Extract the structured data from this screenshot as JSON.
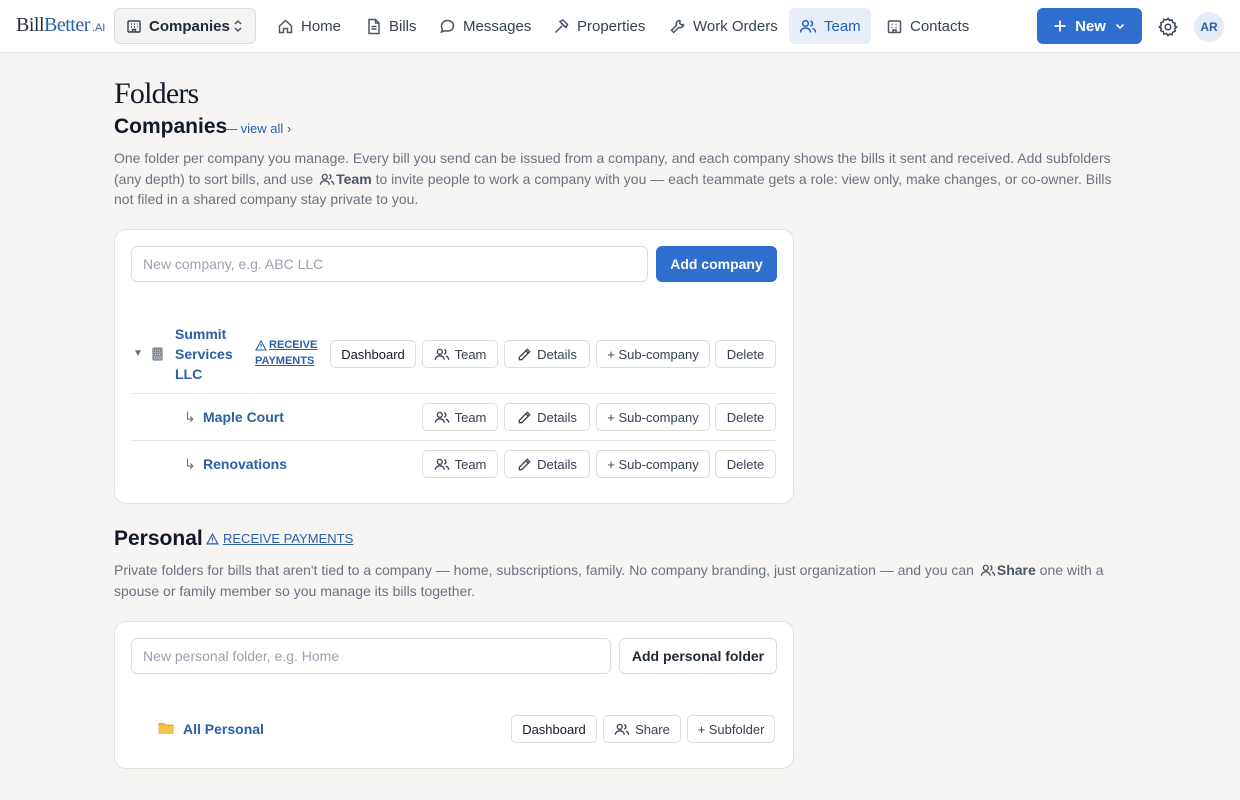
{
  "nav": {
    "logo": {
      "part1": "Bill",
      "part2": "Better",
      "suffix": ".AI"
    },
    "switcher": {
      "label": "Companies"
    },
    "items": [
      {
        "label": "Home",
        "icon": "home-icon"
      },
      {
        "label": "Bills",
        "icon": "document-icon"
      },
      {
        "label": "Messages",
        "icon": "message-icon"
      },
      {
        "label": "Properties",
        "icon": "hammer-icon"
      },
      {
        "label": "Work Orders",
        "icon": "wrench-icon"
      },
      {
        "label": "Team",
        "icon": "users-icon",
        "active": true
      },
      {
        "label": "Contacts",
        "icon": "building-icon"
      }
    ],
    "new_label": "New",
    "avatar_initials": "AR"
  },
  "page": {
    "title": "Folders"
  },
  "companies": {
    "title": "Companies",
    "view_all": "— view all ›",
    "desc_1": "One folder per company you manage. Every bill you send can be issued from a company, and each company shows the bills it sent and received. Add subfolders (any depth) to sort bills, and use",
    "desc_team": "Team",
    "desc_2": "to invite people to work a company with you — each teammate gets a role: view only, make changes, or co-owner. Bills not filed in a shared company stay private to you.",
    "input_placeholder": "New company, e.g. ABC LLC",
    "add_label": "Add company",
    "root": {
      "name_lines": [
        "Summit",
        "Services",
        "LLC"
      ],
      "warning_lines": [
        "RECEIVE",
        "PAYMENTS"
      ],
      "dashboard": "Dashboard"
    },
    "children": [
      {
        "name": "Maple Court"
      },
      {
        "name": "Renovations"
      }
    ],
    "row_actions": {
      "team": "Team",
      "details": "Details",
      "sub_company": "+ Sub-company",
      "delete": "Delete"
    }
  },
  "personal": {
    "title": "Personal",
    "warning": "RECEIVE PAYMENTS",
    "desc_1": "Private folders for bills that aren't tied to a company — home, subscriptions, family. No company branding, just organization — and you can",
    "desc_share": "Share",
    "desc_2": "one with a spouse or family member so you manage its bills together.",
    "input_placeholder": "New personal folder, e.g. Home",
    "add_label": "Add personal folder",
    "folder": {
      "name": "All Personal",
      "dashboard": "Dashboard",
      "share": "Share",
      "subfolder": "+ Subfolder"
    }
  },
  "colors": {
    "accent": "#2f6fd0",
    "link": "#2b5fa8",
    "active_tab_bg": "#e8eef7",
    "background": "#f6f5f3"
  }
}
